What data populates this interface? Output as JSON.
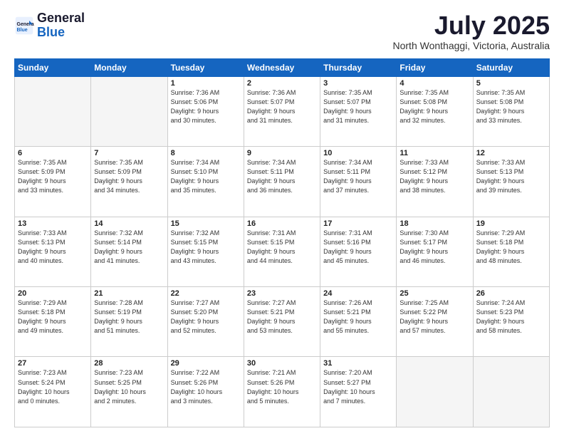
{
  "header": {
    "logo_general": "General",
    "logo_blue": "Blue",
    "month": "July 2025",
    "location": "North Wonthaggi, Victoria, Australia"
  },
  "weekdays": [
    "Sunday",
    "Monday",
    "Tuesday",
    "Wednesday",
    "Thursday",
    "Friday",
    "Saturday"
  ],
  "weeks": [
    [
      {
        "day": "",
        "info": ""
      },
      {
        "day": "",
        "info": ""
      },
      {
        "day": "1",
        "info": "Sunrise: 7:36 AM\nSunset: 5:06 PM\nDaylight: 9 hours\nand 30 minutes."
      },
      {
        "day": "2",
        "info": "Sunrise: 7:36 AM\nSunset: 5:07 PM\nDaylight: 9 hours\nand 31 minutes."
      },
      {
        "day": "3",
        "info": "Sunrise: 7:35 AM\nSunset: 5:07 PM\nDaylight: 9 hours\nand 31 minutes."
      },
      {
        "day": "4",
        "info": "Sunrise: 7:35 AM\nSunset: 5:08 PM\nDaylight: 9 hours\nand 32 minutes."
      },
      {
        "day": "5",
        "info": "Sunrise: 7:35 AM\nSunset: 5:08 PM\nDaylight: 9 hours\nand 33 minutes."
      }
    ],
    [
      {
        "day": "6",
        "info": "Sunrise: 7:35 AM\nSunset: 5:09 PM\nDaylight: 9 hours\nand 33 minutes."
      },
      {
        "day": "7",
        "info": "Sunrise: 7:35 AM\nSunset: 5:09 PM\nDaylight: 9 hours\nand 34 minutes."
      },
      {
        "day": "8",
        "info": "Sunrise: 7:34 AM\nSunset: 5:10 PM\nDaylight: 9 hours\nand 35 minutes."
      },
      {
        "day": "9",
        "info": "Sunrise: 7:34 AM\nSunset: 5:11 PM\nDaylight: 9 hours\nand 36 minutes."
      },
      {
        "day": "10",
        "info": "Sunrise: 7:34 AM\nSunset: 5:11 PM\nDaylight: 9 hours\nand 37 minutes."
      },
      {
        "day": "11",
        "info": "Sunrise: 7:33 AM\nSunset: 5:12 PM\nDaylight: 9 hours\nand 38 minutes."
      },
      {
        "day": "12",
        "info": "Sunrise: 7:33 AM\nSunset: 5:13 PM\nDaylight: 9 hours\nand 39 minutes."
      }
    ],
    [
      {
        "day": "13",
        "info": "Sunrise: 7:33 AM\nSunset: 5:13 PM\nDaylight: 9 hours\nand 40 minutes."
      },
      {
        "day": "14",
        "info": "Sunrise: 7:32 AM\nSunset: 5:14 PM\nDaylight: 9 hours\nand 41 minutes."
      },
      {
        "day": "15",
        "info": "Sunrise: 7:32 AM\nSunset: 5:15 PM\nDaylight: 9 hours\nand 43 minutes."
      },
      {
        "day": "16",
        "info": "Sunrise: 7:31 AM\nSunset: 5:15 PM\nDaylight: 9 hours\nand 44 minutes."
      },
      {
        "day": "17",
        "info": "Sunrise: 7:31 AM\nSunset: 5:16 PM\nDaylight: 9 hours\nand 45 minutes."
      },
      {
        "day": "18",
        "info": "Sunrise: 7:30 AM\nSunset: 5:17 PM\nDaylight: 9 hours\nand 46 minutes."
      },
      {
        "day": "19",
        "info": "Sunrise: 7:29 AM\nSunset: 5:18 PM\nDaylight: 9 hours\nand 48 minutes."
      }
    ],
    [
      {
        "day": "20",
        "info": "Sunrise: 7:29 AM\nSunset: 5:18 PM\nDaylight: 9 hours\nand 49 minutes."
      },
      {
        "day": "21",
        "info": "Sunrise: 7:28 AM\nSunset: 5:19 PM\nDaylight: 9 hours\nand 51 minutes."
      },
      {
        "day": "22",
        "info": "Sunrise: 7:27 AM\nSunset: 5:20 PM\nDaylight: 9 hours\nand 52 minutes."
      },
      {
        "day": "23",
        "info": "Sunrise: 7:27 AM\nSunset: 5:21 PM\nDaylight: 9 hours\nand 53 minutes."
      },
      {
        "day": "24",
        "info": "Sunrise: 7:26 AM\nSunset: 5:21 PM\nDaylight: 9 hours\nand 55 minutes."
      },
      {
        "day": "25",
        "info": "Sunrise: 7:25 AM\nSunset: 5:22 PM\nDaylight: 9 hours\nand 57 minutes."
      },
      {
        "day": "26",
        "info": "Sunrise: 7:24 AM\nSunset: 5:23 PM\nDaylight: 9 hours\nand 58 minutes."
      }
    ],
    [
      {
        "day": "27",
        "info": "Sunrise: 7:23 AM\nSunset: 5:24 PM\nDaylight: 10 hours\nand 0 minutes."
      },
      {
        "day": "28",
        "info": "Sunrise: 7:23 AM\nSunset: 5:25 PM\nDaylight: 10 hours\nand 2 minutes."
      },
      {
        "day": "29",
        "info": "Sunrise: 7:22 AM\nSunset: 5:26 PM\nDaylight: 10 hours\nand 3 minutes."
      },
      {
        "day": "30",
        "info": "Sunrise: 7:21 AM\nSunset: 5:26 PM\nDaylight: 10 hours\nand 5 minutes."
      },
      {
        "day": "31",
        "info": "Sunrise: 7:20 AM\nSunset: 5:27 PM\nDaylight: 10 hours\nand 7 minutes."
      },
      {
        "day": "",
        "info": ""
      },
      {
        "day": "",
        "info": ""
      }
    ]
  ]
}
